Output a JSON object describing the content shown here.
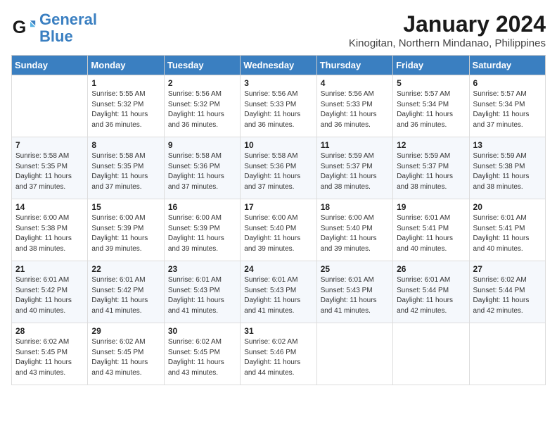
{
  "logo": {
    "line1": "General",
    "line2": "Blue"
  },
  "title": "January 2024",
  "location": "Kinogitan, Northern Mindanao, Philippines",
  "headers": [
    "Sunday",
    "Monday",
    "Tuesday",
    "Wednesday",
    "Thursday",
    "Friday",
    "Saturday"
  ],
  "weeks": [
    [
      {
        "day": "",
        "info": ""
      },
      {
        "day": "1",
        "info": "Sunrise: 5:55 AM\nSunset: 5:32 PM\nDaylight: 11 hours\nand 36 minutes."
      },
      {
        "day": "2",
        "info": "Sunrise: 5:56 AM\nSunset: 5:32 PM\nDaylight: 11 hours\nand 36 minutes."
      },
      {
        "day": "3",
        "info": "Sunrise: 5:56 AM\nSunset: 5:33 PM\nDaylight: 11 hours\nand 36 minutes."
      },
      {
        "day": "4",
        "info": "Sunrise: 5:56 AM\nSunset: 5:33 PM\nDaylight: 11 hours\nand 36 minutes."
      },
      {
        "day": "5",
        "info": "Sunrise: 5:57 AM\nSunset: 5:34 PM\nDaylight: 11 hours\nand 36 minutes."
      },
      {
        "day": "6",
        "info": "Sunrise: 5:57 AM\nSunset: 5:34 PM\nDaylight: 11 hours\nand 37 minutes."
      }
    ],
    [
      {
        "day": "7",
        "info": "Sunrise: 5:58 AM\nSunset: 5:35 PM\nDaylight: 11 hours\nand 37 minutes."
      },
      {
        "day": "8",
        "info": "Sunrise: 5:58 AM\nSunset: 5:35 PM\nDaylight: 11 hours\nand 37 minutes."
      },
      {
        "day": "9",
        "info": "Sunrise: 5:58 AM\nSunset: 5:36 PM\nDaylight: 11 hours\nand 37 minutes."
      },
      {
        "day": "10",
        "info": "Sunrise: 5:58 AM\nSunset: 5:36 PM\nDaylight: 11 hours\nand 37 minutes."
      },
      {
        "day": "11",
        "info": "Sunrise: 5:59 AM\nSunset: 5:37 PM\nDaylight: 11 hours\nand 38 minutes."
      },
      {
        "day": "12",
        "info": "Sunrise: 5:59 AM\nSunset: 5:37 PM\nDaylight: 11 hours\nand 38 minutes."
      },
      {
        "day": "13",
        "info": "Sunrise: 5:59 AM\nSunset: 5:38 PM\nDaylight: 11 hours\nand 38 minutes."
      }
    ],
    [
      {
        "day": "14",
        "info": "Sunrise: 6:00 AM\nSunset: 5:38 PM\nDaylight: 11 hours\nand 38 minutes."
      },
      {
        "day": "15",
        "info": "Sunrise: 6:00 AM\nSunset: 5:39 PM\nDaylight: 11 hours\nand 39 minutes."
      },
      {
        "day": "16",
        "info": "Sunrise: 6:00 AM\nSunset: 5:39 PM\nDaylight: 11 hours\nand 39 minutes."
      },
      {
        "day": "17",
        "info": "Sunrise: 6:00 AM\nSunset: 5:40 PM\nDaylight: 11 hours\nand 39 minutes."
      },
      {
        "day": "18",
        "info": "Sunrise: 6:00 AM\nSunset: 5:40 PM\nDaylight: 11 hours\nand 39 minutes."
      },
      {
        "day": "19",
        "info": "Sunrise: 6:01 AM\nSunset: 5:41 PM\nDaylight: 11 hours\nand 40 minutes."
      },
      {
        "day": "20",
        "info": "Sunrise: 6:01 AM\nSunset: 5:41 PM\nDaylight: 11 hours\nand 40 minutes."
      }
    ],
    [
      {
        "day": "21",
        "info": "Sunrise: 6:01 AM\nSunset: 5:42 PM\nDaylight: 11 hours\nand 40 minutes."
      },
      {
        "day": "22",
        "info": "Sunrise: 6:01 AM\nSunset: 5:42 PM\nDaylight: 11 hours\nand 41 minutes."
      },
      {
        "day": "23",
        "info": "Sunrise: 6:01 AM\nSunset: 5:43 PM\nDaylight: 11 hours\nand 41 minutes."
      },
      {
        "day": "24",
        "info": "Sunrise: 6:01 AM\nSunset: 5:43 PM\nDaylight: 11 hours\nand 41 minutes."
      },
      {
        "day": "25",
        "info": "Sunrise: 6:01 AM\nSunset: 5:43 PM\nDaylight: 11 hours\nand 41 minutes."
      },
      {
        "day": "26",
        "info": "Sunrise: 6:01 AM\nSunset: 5:44 PM\nDaylight: 11 hours\nand 42 minutes."
      },
      {
        "day": "27",
        "info": "Sunrise: 6:02 AM\nSunset: 5:44 PM\nDaylight: 11 hours\nand 42 minutes."
      }
    ],
    [
      {
        "day": "28",
        "info": "Sunrise: 6:02 AM\nSunset: 5:45 PM\nDaylight: 11 hours\nand 43 minutes."
      },
      {
        "day": "29",
        "info": "Sunrise: 6:02 AM\nSunset: 5:45 PM\nDaylight: 11 hours\nand 43 minutes."
      },
      {
        "day": "30",
        "info": "Sunrise: 6:02 AM\nSunset: 5:45 PM\nDaylight: 11 hours\nand 43 minutes."
      },
      {
        "day": "31",
        "info": "Sunrise: 6:02 AM\nSunset: 5:46 PM\nDaylight: 11 hours\nand 44 minutes."
      },
      {
        "day": "",
        "info": ""
      },
      {
        "day": "",
        "info": ""
      },
      {
        "day": "",
        "info": ""
      }
    ]
  ]
}
